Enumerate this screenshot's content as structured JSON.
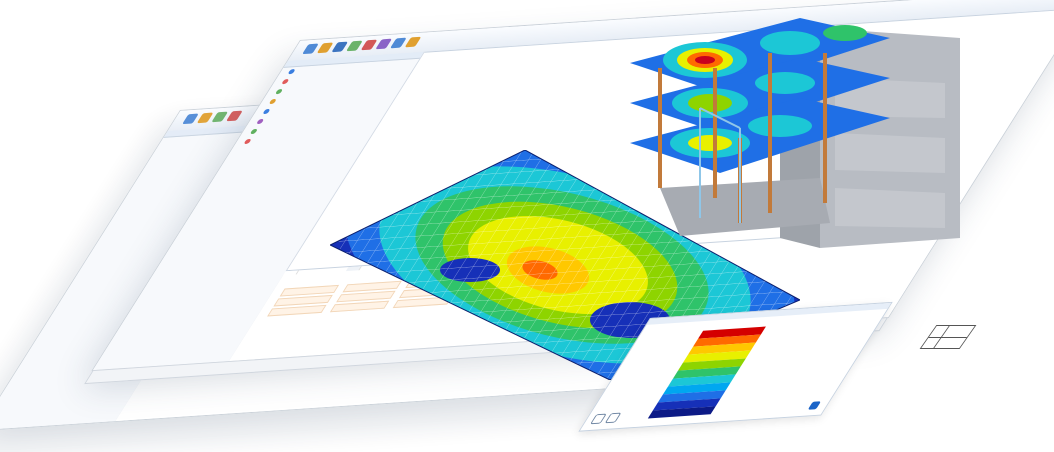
{
  "window": {
    "title": "",
    "navigator_title": "",
    "nav_items": [
      {
        "label": "",
        "color": "#3a7ee0"
      },
      {
        "label": "",
        "color": "#e05b5b"
      },
      {
        "label": "",
        "color": "#60b060"
      },
      {
        "label": "",
        "color": "#e0a030"
      },
      {
        "label": "",
        "color": "#3a7ee0"
      },
      {
        "label": "",
        "color": "#a060c0"
      },
      {
        "label": "",
        "color": "#60b060"
      },
      {
        "label": "",
        "color": "#e05b5b"
      }
    ],
    "bottom_tabs": [
      "",
      "",
      "",
      ""
    ],
    "status_text": ""
  },
  "legend": {
    "title": "",
    "colors": [
      "#d40000",
      "#ff6a00",
      "#ffc800",
      "#e8f000",
      "#8ed400",
      "#2fc36a",
      "#1cc7d6",
      "#00a7f0",
      "#1f6fe6",
      "#1630b8",
      "#0c1a86"
    ],
    "values": [
      "",
      "",
      "",
      "",
      "",
      "",
      "",
      "",
      "",
      "",
      ""
    ],
    "percents": [
      "",
      "",
      "",
      "",
      "",
      "",
      "",
      "",
      "",
      "",
      ""
    ]
  },
  "colors": {
    "accent": "#1a64c8",
    "window_border": "#c9d0d8"
  }
}
